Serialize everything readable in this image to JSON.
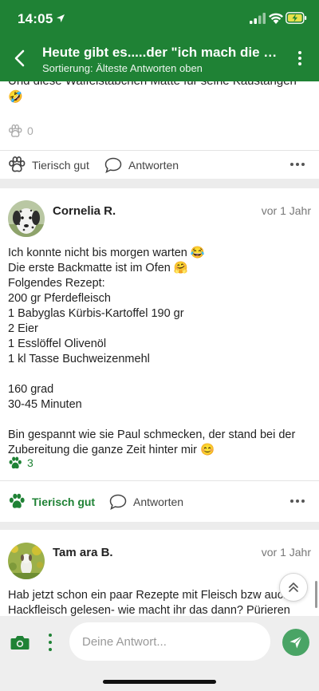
{
  "status_bar": {
    "time": "14:05"
  },
  "header": {
    "title": "Heute gibt es.....der \"ich mach die Le...",
    "subtitle": "Sortierung: Älteste Antworten oben"
  },
  "posts": [
    {
      "partial_text": "Und diese Waffelstäbchen Matte für seine Kaustangen 🤣",
      "likes": "0",
      "like_label": "Tierisch gut",
      "reply_label": "Antworten"
    },
    {
      "author": "Cornelia R.",
      "time": "vor 1 Jahr",
      "lines": [
        "Ich konnte nicht bis morgen warten 😂",
        "Die erste Backmatte ist im Ofen 🤗",
        "Folgendes Rezept:",
        "200 gr Pferdefleisch",
        "1 Babyglas Kürbis-Kartoffel 190 gr",
        "2 Eier",
        "1 Esslöffel Olivenöl",
        "1 kl Tasse Buchweizenmehl",
        "160 grad",
        "30-45 Minuten",
        "Bin gespannt wie sie Paul schmecken, der stand bei der Zubereitung die ganze Zeit hinter mir 😊"
      ],
      "likes": "3",
      "like_label": "Tierisch gut",
      "reply_label": "Antworten"
    },
    {
      "author": "Tam ara B.",
      "time": "vor 1 Jahr",
      "text": "Hab jetzt schon ein paar Rezepte mit Fleisch bzw auch Hackfleisch gelesen- wie macht ihr das dann? Pürieren"
    }
  ],
  "composer": {
    "placeholder": "Deine Antwort..."
  },
  "colors": {
    "brand": "#1f8235",
    "send": "#49a465"
  },
  "icons": [
    "back-arrow-icon",
    "more-vertical-icon",
    "paw-icon",
    "speech-bubble-icon",
    "more-horizontal-icon",
    "camera-icon",
    "send-icon",
    "double-chevron-up-icon"
  ]
}
